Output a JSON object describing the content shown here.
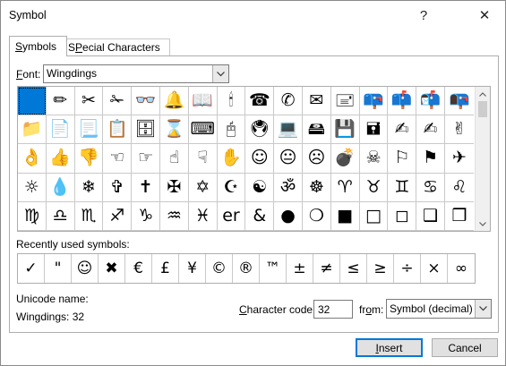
{
  "window": {
    "title": "Symbol",
    "help_glyph": "?",
    "close_glyph": "✕"
  },
  "tabs": [
    {
      "accel": "S",
      "rest": "ymbols",
      "active": true
    },
    {
      "accel": "P",
      "rest": "ecial Characters",
      "prefix": "S",
      "active": false
    }
  ],
  "font": {
    "accel": "F",
    "rest": "ont:",
    "value": "Wingdings"
  },
  "symbol_grid": [
    " ",
    "✏",
    "✂",
    "✁",
    "👓",
    "🔔",
    "📖",
    "🕯",
    "☎",
    "✆",
    "✉",
    "🖃",
    "📪",
    "📫",
    "📬",
    "📭",
    "📁",
    "📄",
    "📃",
    "📋",
    "🗄",
    "⌛",
    "⌨",
    "🖰",
    "🖲",
    "💻",
    "🖴",
    "💾",
    "🖬",
    "✍",
    "✍",
    "✌",
    "👌",
    "👍",
    "👎",
    "☜",
    "☞",
    "☝",
    "☟",
    "✋",
    "☺",
    "😐",
    "☹",
    "💣",
    "☠",
    "⚐",
    "⚑",
    "✈",
    "☼",
    "💧",
    "❄",
    "✞",
    "✝",
    "✠",
    "✡",
    "☪",
    "☯",
    "ॐ",
    "☸",
    "♈",
    "♉",
    "♊",
    "♋",
    "♌",
    "♍",
    "♎",
    "♏",
    "♐",
    "♑",
    "♒",
    "♓",
    "𝓮𝓽",
    "&",
    "●",
    "❍",
    "■",
    "□",
    "◻",
    "❑",
    "❒"
  ],
  "grid_visible_override": [
    "",
    "✏",
    "✂",
    "✁",
    "👓",
    "🔔",
    "📖",
    "🕯",
    "☎",
    "✆",
    "✉",
    "🖃",
    "📪",
    "📫",
    "📬",
    "📭",
    "📁",
    "📄",
    "📃",
    "📋",
    "🗄",
    "⌛",
    "⌨",
    "🖰",
    "🖲",
    "💻",
    "🖴",
    "💾",
    "🖬",
    "✍",
    "✍",
    "✌",
    "👌",
    "👍",
    "👎",
    "☜",
    "☞",
    "☝",
    "☟",
    "✋",
    "☺",
    "😐",
    "☹",
    "💣",
    "☠",
    "⚐",
    "⚑",
    "✈",
    "☼",
    "💧",
    "❄",
    "✞",
    "✝",
    "✠",
    "✡",
    "☪",
    "☯",
    "ॐ",
    "☸",
    "♈",
    "♉",
    "♊",
    "♋",
    "♌",
    "♍",
    "♎",
    "♏",
    "♐",
    "♑",
    "♒",
    "♓",
    "er",
    "&",
    "●",
    "❍",
    "■",
    "□",
    "◻",
    "❑",
    "❒"
  ],
  "recent": {
    "label": "Recently used symbols:",
    "symbols": [
      "✓",
      "\"",
      "☺",
      "✖",
      "€",
      "£",
      "¥",
      "©",
      "®",
      "™",
      "±",
      "≠",
      "≤",
      "≥",
      "÷",
      "×",
      "∞"
    ]
  },
  "unicode": {
    "label": "Unicode name:",
    "value": "Wingdings: 32"
  },
  "char_code": {
    "accel": "C",
    "rest": "haracter code:",
    "value": "32"
  },
  "from": {
    "pre": "fr",
    "accel": "o",
    "rest": "m:",
    "value": "Symbol (decimal)"
  },
  "buttons": {
    "insert_accel": "I",
    "insert_rest": "nsert",
    "cancel": "Cancel"
  },
  "colors": {
    "selection": "#0078d7"
  }
}
